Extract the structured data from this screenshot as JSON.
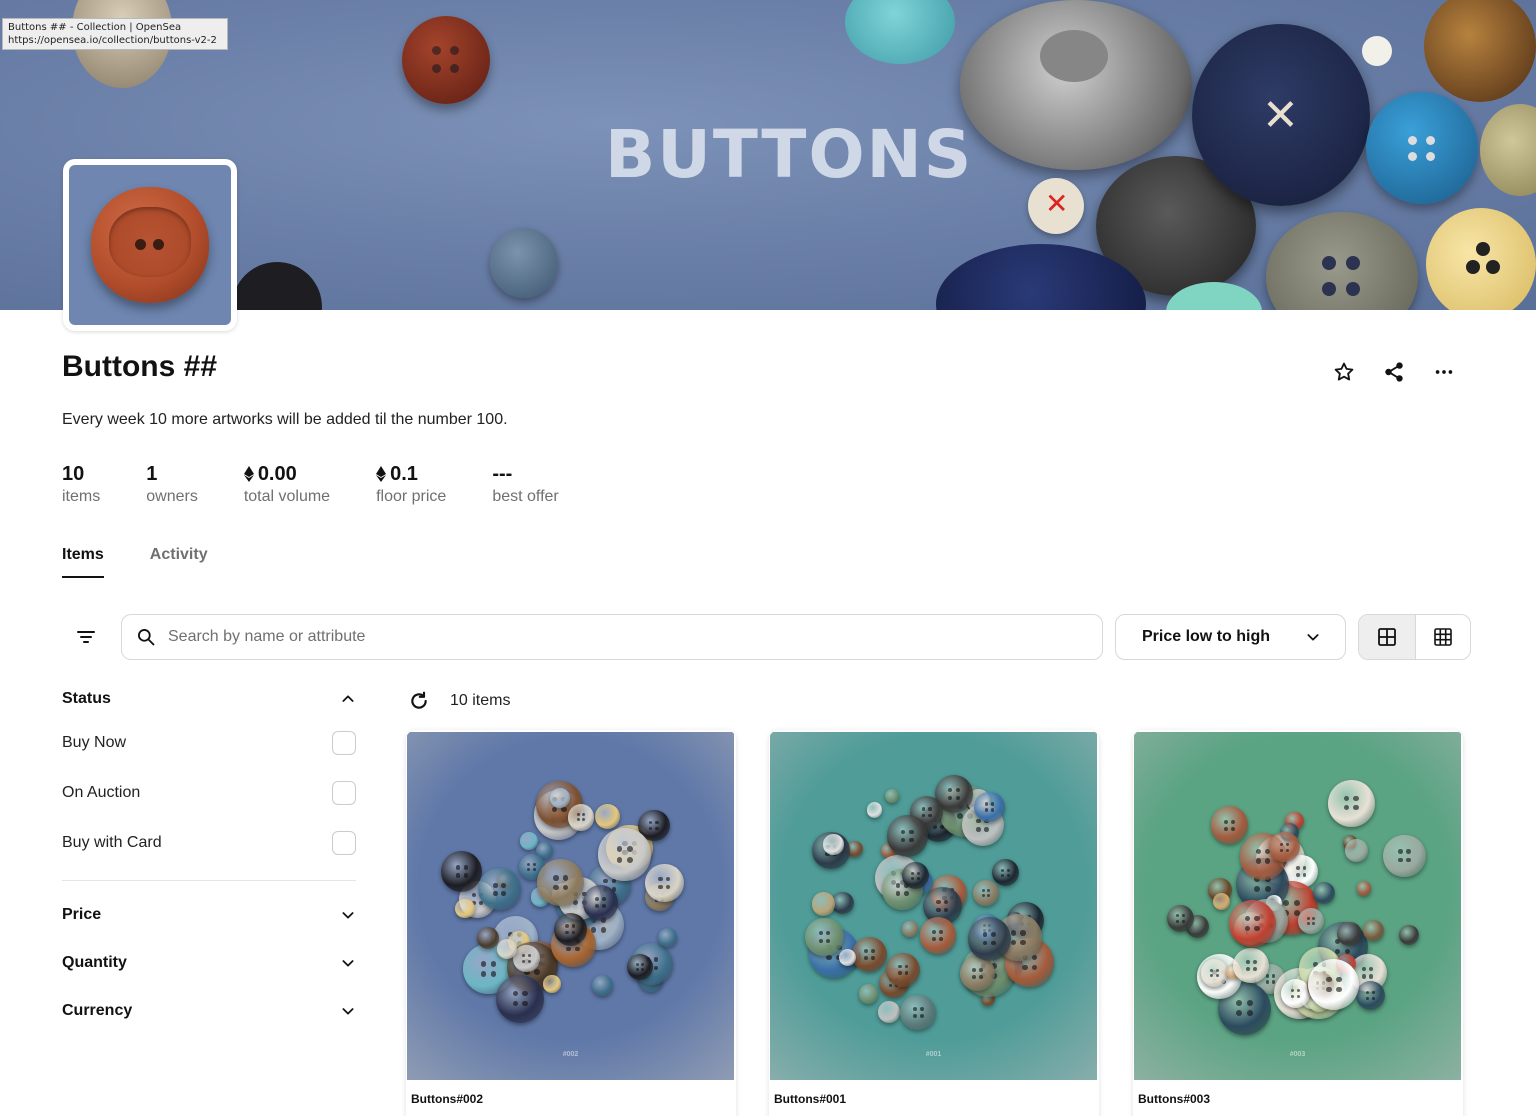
{
  "tooltip": {
    "line1": "Buttons ## - Collection | OpenSea",
    "line2": "https://opensea.io/collection/buttons-v2-2"
  },
  "banner": {
    "text": "BUTTONS"
  },
  "collection": {
    "name": "Buttons ##",
    "description": "Every week 10 more artworks will be added til the number 100."
  },
  "actions": {
    "favorite_icon": "star-icon",
    "share_icon": "share-icon",
    "more_icon": "more-horizontal-icon"
  },
  "stats": [
    {
      "value": "10",
      "label": "items",
      "eth": false
    },
    {
      "value": "1",
      "label": "owners",
      "eth": false
    },
    {
      "value": "0.00",
      "label": "total volume",
      "eth": true
    },
    {
      "value": "0.1",
      "label": "floor price",
      "eth": true
    },
    {
      "value": "---",
      "label": "best offer",
      "eth": false
    }
  ],
  "tabs": [
    {
      "label": "Items",
      "active": true
    },
    {
      "label": "Activity",
      "active": false
    }
  ],
  "toolbar": {
    "search_placeholder": "Search by name or attribute",
    "search_value": "",
    "sort_label": "Price low to high"
  },
  "sidebar": {
    "status_title": "Status",
    "status_options": [
      "Buy Now",
      "On Auction",
      "Buy with Card"
    ],
    "sections": [
      "Price",
      "Quantity",
      "Currency"
    ]
  },
  "results": {
    "count_label": "10 items"
  },
  "cards": [
    {
      "name": "Buttons#002",
      "mark": "#002",
      "bg": "#5f78a8"
    },
    {
      "name": "Buttons#001",
      "mark": "#001",
      "bg": "#4f9c98"
    },
    {
      "name": "Buttons#003",
      "mark": "#003",
      "bg": "#5aa383"
    }
  ],
  "colors": {
    "banner_blue": "#6b80a8",
    "text_primary": "#121212",
    "text_secondary": "#707070",
    "border": "#d8d8d8"
  }
}
